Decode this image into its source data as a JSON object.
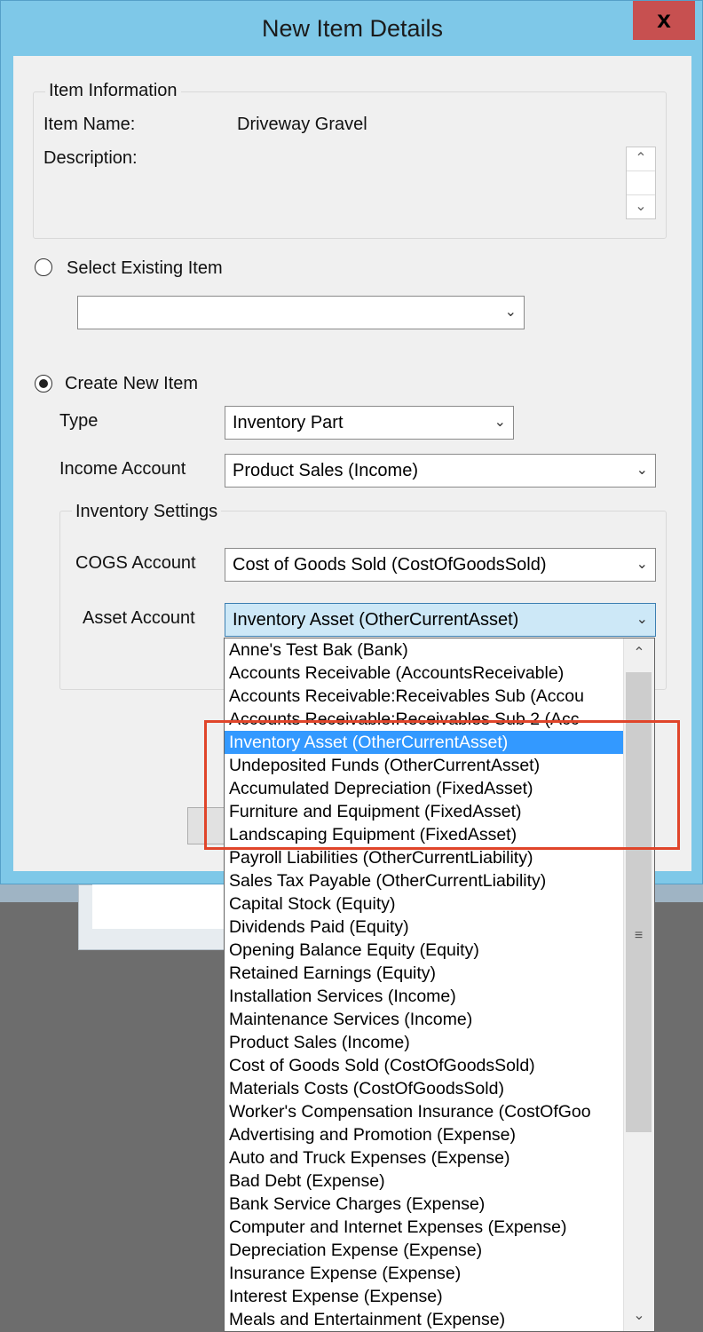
{
  "window": {
    "title": "New Item Details",
    "close_glyph": "x"
  },
  "item_info": {
    "group_title": "Item Information",
    "name_label": "Item Name:",
    "name_value": "Driveway Gravel",
    "description_label": "Description:"
  },
  "select_existing": {
    "label": "Select Existing Item",
    "value": "",
    "selected": false
  },
  "create_new": {
    "label": "Create New Item",
    "selected": true
  },
  "type": {
    "label": "Type",
    "value": "Inventory Part"
  },
  "income_account": {
    "label": "Income Account",
    "value": "Product Sales  (Income)"
  },
  "inventory_settings": {
    "group_title": "Inventory Settings",
    "cogs_label": "COGS Account",
    "cogs_value": "Cost of Goods Sold  (CostOfGoodsSold)",
    "asset_label": "Asset Account",
    "asset_value": "Inventory Asset  (OtherCurrentAsset)"
  },
  "dropdown": {
    "items": [
      "Anne's Test Bak  (Bank)",
      "Accounts Receivable  (AccountsReceivable)",
      "Accounts Receivable:Receivables Sub  (Accou",
      "Accounts Receivable:Receivables Sub 2  (Acc",
      "Inventory Asset  (OtherCurrentAsset)",
      "Undeposited Funds  (OtherCurrentAsset)",
      "Accumulated Depreciation  (FixedAsset)",
      "Furniture and Equipment  (FixedAsset)",
      "Landscaping Equipment  (FixedAsset)",
      "Payroll Liabilities  (OtherCurrentLiability)",
      "Sales Tax Payable  (OtherCurrentLiability)",
      "Capital Stock  (Equity)",
      "Dividends Paid  (Equity)",
      "Opening Balance Equity  (Equity)",
      "Retained Earnings  (Equity)",
      "Installation Services  (Income)",
      "Maintenance Services  (Income)",
      "Product Sales  (Income)",
      "Cost of Goods Sold  (CostOfGoodsSold)",
      "Materials Costs  (CostOfGoodsSold)",
      "Worker's Compensation Insurance  (CostOfGoo",
      "Advertising and Promotion  (Expense)",
      "Auto and Truck Expenses  (Expense)",
      "Bad Debt  (Expense)",
      "Bank Service Charges  (Expense)",
      "Computer and Internet Expenses  (Expense)",
      "Depreciation Expense  (Expense)",
      "Insurance Expense  (Expense)",
      "Interest Expense  (Expense)",
      "Meals and Entertainment  (Expense)"
    ],
    "selected_index": 4
  },
  "colors": {
    "titlebar": "#7ec8e8",
    "close": "#c75050",
    "selection": "#3399ff",
    "highlight_box": "#e0452a"
  }
}
